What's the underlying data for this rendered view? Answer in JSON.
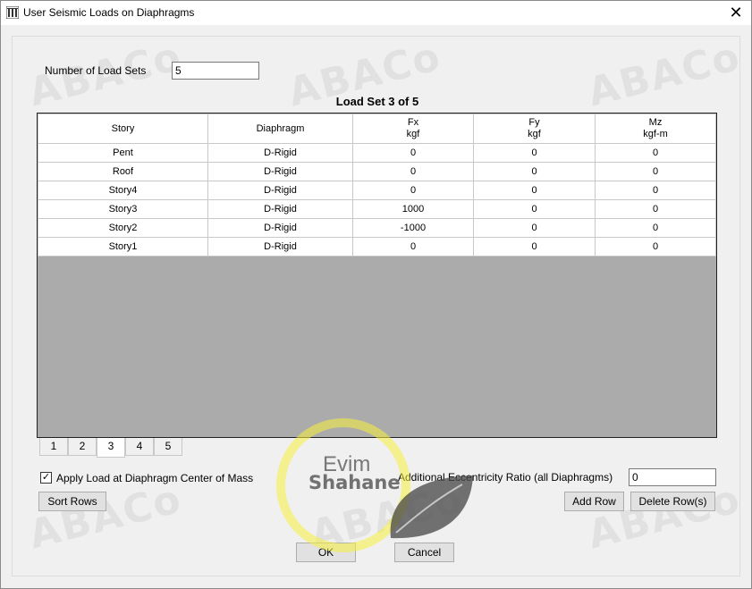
{
  "window": {
    "title": "User Seismic Loads on Diaphragms",
    "close_glyph": "✕"
  },
  "load_sets": {
    "label": "Number of Load Sets",
    "value": "5"
  },
  "grid": {
    "title": "Load Set 3 of 5",
    "columns": [
      {
        "name": "Story",
        "unit": ""
      },
      {
        "name": "Diaphragm",
        "unit": ""
      },
      {
        "name": "Fx",
        "unit": "kgf"
      },
      {
        "name": "Fy",
        "unit": "kgf"
      },
      {
        "name": "Mz",
        "unit": "kgf-m"
      }
    ],
    "rows": [
      [
        "Pent",
        "D-Rigid",
        "0",
        "0",
        "0"
      ],
      [
        "Roof",
        "D-Rigid",
        "0",
        "0",
        "0"
      ],
      [
        "Story4",
        "D-Rigid",
        "0",
        "0",
        "0"
      ],
      [
        "Story3",
        "D-Rigid",
        "1000",
        "0",
        "0"
      ],
      [
        "Story2",
        "D-Rigid",
        "-1000",
        "0",
        "0"
      ],
      [
        "Story1",
        "D-Rigid",
        "0",
        "0",
        "0"
      ]
    ]
  },
  "tabs": [
    "1",
    "2",
    "3",
    "4",
    "5"
  ],
  "active_tab": 2,
  "options": {
    "apply_center_mass_label": "Apply Load at Diaphragm Center of Mass",
    "apply_center_mass_checked": true,
    "check_glyph": "✓",
    "eccentricity_label": "Additional Eccentricity Ratio (all Diaphragms)",
    "eccentricity_value": "0"
  },
  "buttons": {
    "sort_rows": "Sort Rows",
    "add_row": "Add Row",
    "delete_rows": "Delete Row(s)",
    "ok": "OK",
    "cancel": "Cancel"
  },
  "watermark": {
    "brand": "ABACo",
    "logo_line1": "Evim",
    "logo_line2": "Shahane",
    "ring_color": "#f5f03c"
  },
  "colors": {
    "dialog_bg": "#f0f0f0",
    "grid_empty": "#ababab"
  }
}
